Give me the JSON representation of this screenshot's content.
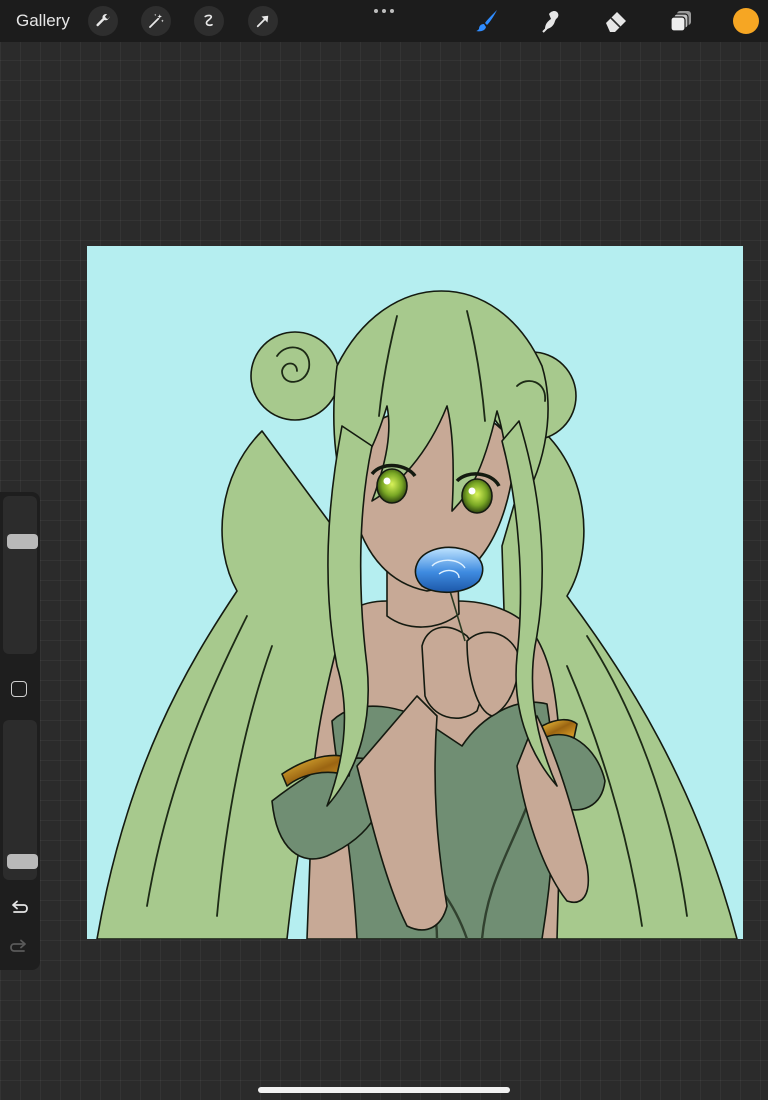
{
  "topbar": {
    "gallery_label": "Gallery",
    "left_tools": [
      "wrench-icon",
      "magic-wand-icon",
      "selection-icon",
      "transform-icon"
    ],
    "more_icon": "ellipsis-icon",
    "right_tools": [
      "brush-icon",
      "smudge-icon",
      "eraser-icon",
      "layers-icon"
    ],
    "active_tool": "brush-icon",
    "current_color": "#f6a623",
    "accent_color": "#2f8cff"
  },
  "sidebar": {
    "size_slider": 0.75,
    "opacity_slider": 0.05,
    "modifier_icon": "square-modifier-icon",
    "undo_icon": "undo-icon",
    "redo_icon": "redo-icon"
  },
  "canvas": {
    "background_color": "#b5eef0",
    "artwork": "anime-girl-green-hair-blue-rose"
  }
}
